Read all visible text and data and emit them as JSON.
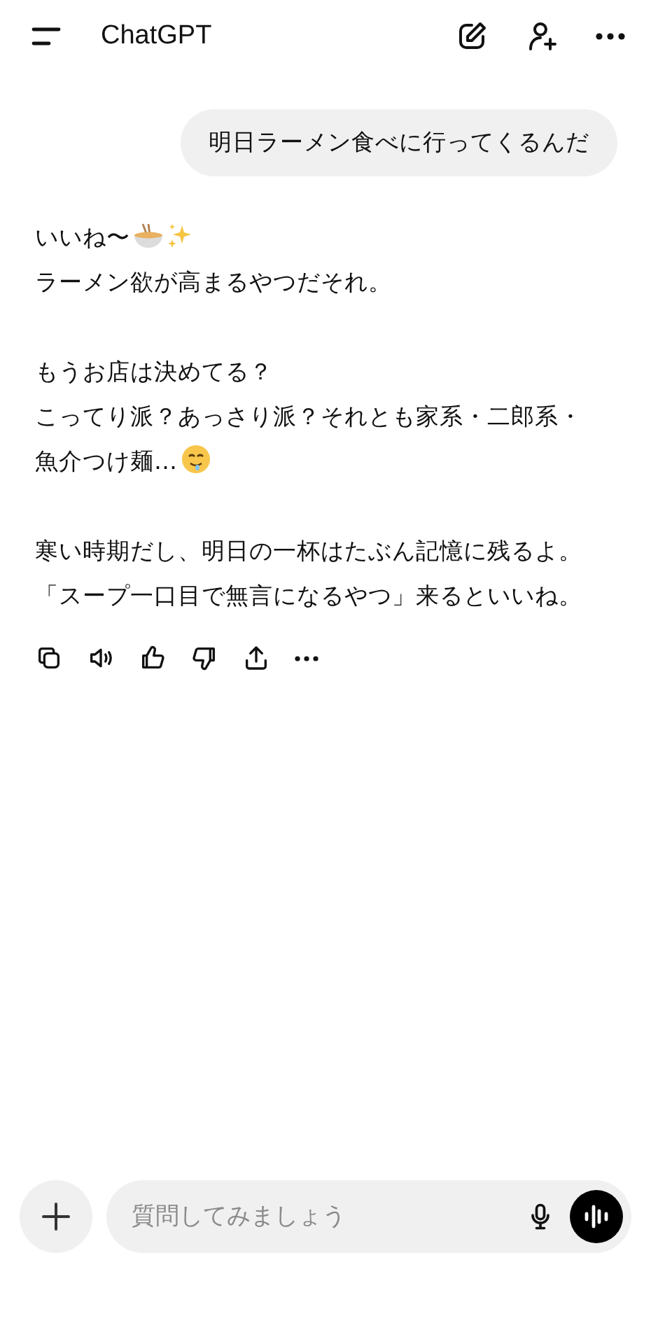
{
  "header": {
    "title": "ChatGPT"
  },
  "user_message": {
    "text": "明日ラーメン食べに行ってくるんだ"
  },
  "assistant_message": {
    "paragraphs": [
      {
        "lines": [
          "いいね〜",
          "ラーメン欲が高まるやつだそれ。"
        ]
      },
      {
        "lines": [
          "もうお店は決めてる？",
          "こってり派？あっさり派？それとも家系・二郎系・",
          "魚介つけ麺…"
        ]
      },
      {
        "lines": [
          "寒い時期だし、明日の一杯はたぶん記憶に残るよ。",
          "「スープ一口目で無言になるやつ」来るといいね。"
        ]
      }
    ]
  },
  "composer": {
    "placeholder": "質問してみましょう"
  }
}
